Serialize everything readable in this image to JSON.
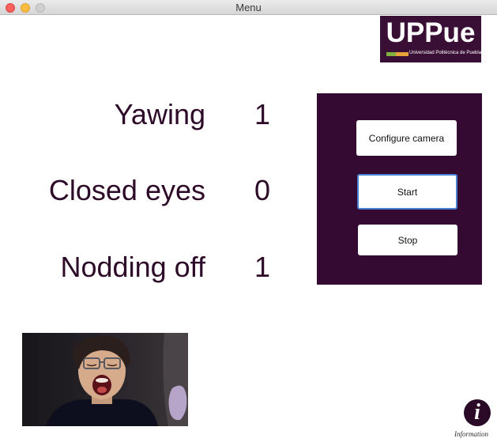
{
  "window": {
    "title": "Menu"
  },
  "logo": {
    "text": "UPPue",
    "subtitle": "Universidad Politécnica de Puebla"
  },
  "stats": [
    {
      "label": "Yawing",
      "value": "1"
    },
    {
      "label": "Closed eyes",
      "value": "0"
    },
    {
      "label": "Nodding off",
      "value": "1"
    }
  ],
  "panel": {
    "configure_label": "Configure camera",
    "start_label": "Start",
    "stop_label": "Stop"
  },
  "info": {
    "label": "Information"
  },
  "colors": {
    "panel_bg": "#350a32",
    "text": "#2c0a28",
    "accent_green": "#7fb040",
    "accent_orange": "#e9a23b"
  }
}
